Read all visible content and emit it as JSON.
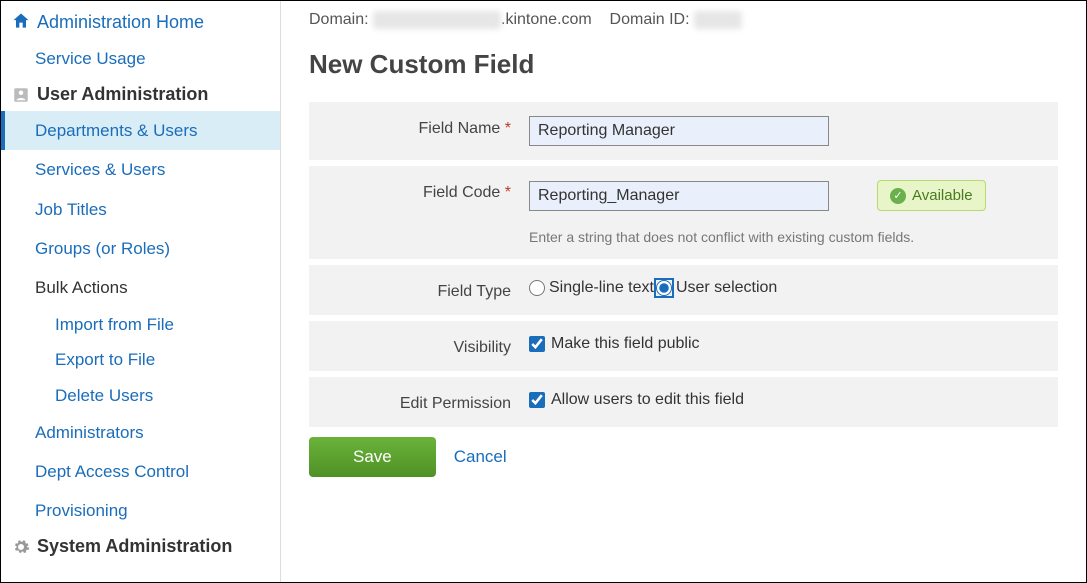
{
  "sidebar": {
    "home_label": "Administration Home",
    "service_usage_label": "Service Usage",
    "user_admin_label": "User Administration",
    "items": [
      {
        "label": "Departments & Users"
      },
      {
        "label": "Services & Users"
      },
      {
        "label": "Job Titles"
      },
      {
        "label": "Groups (or Roles)"
      },
      {
        "label": "Bulk Actions"
      },
      {
        "label": "Administrators"
      },
      {
        "label": "Dept Access Control"
      },
      {
        "label": "Provisioning"
      }
    ],
    "bulk_subitems": [
      {
        "label": "Import from File"
      },
      {
        "label": "Export to File"
      },
      {
        "label": "Delete Users"
      }
    ],
    "system_admin_label": "System Administration"
  },
  "header": {
    "domain_label": "Domain:",
    "domain_masked": "xxxxxxxxxxxxxxxx",
    "domain_suffix": ".kintone.com",
    "domain_id_label": "Domain ID:",
    "domain_id_masked": "xxxxxx"
  },
  "page": {
    "title": "New Custom Field"
  },
  "form": {
    "field_name_label": "Field Name",
    "field_name_value": "Reporting Manager",
    "field_code_label": "Field Code",
    "field_code_value": "Reporting_Manager",
    "field_code_help": "Enter a string that does not conflict with existing custom fields.",
    "available_badge": "Available",
    "field_type_label": "Field Type",
    "field_type_options": {
      "single_line": "Single-line text",
      "user_selection": "User selection"
    },
    "field_type_selected": "user_selection",
    "visibility_label": "Visibility",
    "visibility_option": "Make this field public",
    "visibility_checked": true,
    "edit_permission_label": "Edit Permission",
    "edit_permission_option": "Allow users to edit this field",
    "edit_permission_checked": true,
    "save_label": "Save",
    "cancel_label": "Cancel"
  }
}
